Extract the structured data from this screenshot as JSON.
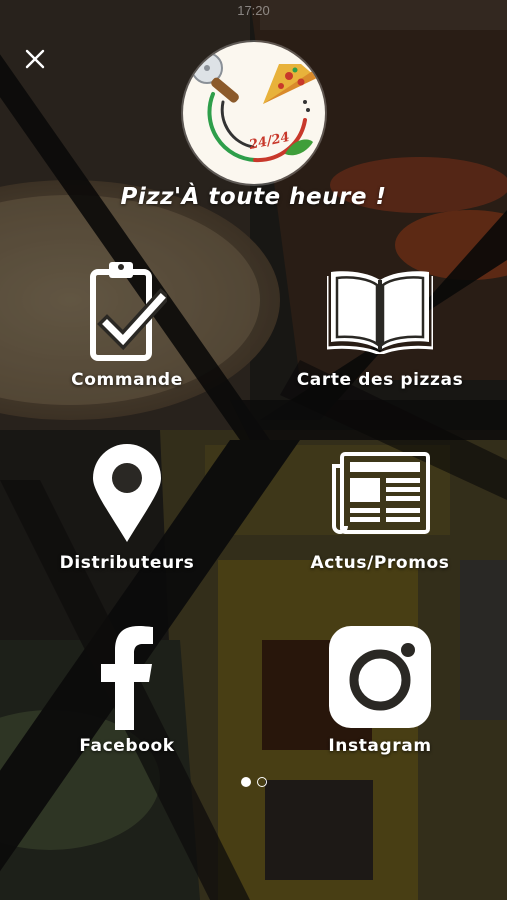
{
  "status_bar": {
    "time": "17:20"
  },
  "header": {
    "close_icon": "close-icon",
    "brand_name": "Pizz'À toute heure !",
    "logo_text": "24/24"
  },
  "menu": [
    {
      "id": "commande",
      "label": "Commande",
      "icon": "clipboard-check-icon"
    },
    {
      "id": "carte",
      "label": "Carte des pizzas",
      "icon": "open-book-icon"
    },
    {
      "id": "distributeurs",
      "label": "Distributeurs",
      "icon": "map-pin-icon"
    },
    {
      "id": "actus",
      "label": "Actus/Promos",
      "icon": "newspaper-icon"
    },
    {
      "id": "facebook",
      "label": "Facebook",
      "icon": "facebook-icon"
    },
    {
      "id": "instagram",
      "label": "Instagram",
      "icon": "instagram-icon"
    }
  ],
  "pager": {
    "pages": 2,
    "current": 1
  },
  "colors": {
    "accent_green": "#2e9e4a",
    "accent_red": "#c8382b",
    "logo_bg": "#fbf7ef"
  }
}
